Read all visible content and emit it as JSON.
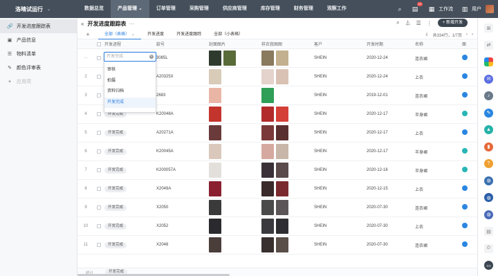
{
  "app": {
    "name": "洛晴试运行",
    "caret": "⌄"
  },
  "nav": [
    {
      "label": "数据总览",
      "active": false
    },
    {
      "label": "产品管理 ⌄",
      "active": true
    },
    {
      "label": "订单管理",
      "active": false
    },
    {
      "label": "采购管理",
      "active": false
    },
    {
      "label": "供应商管理",
      "active": false
    },
    {
      "label": "库存管理",
      "active": false
    },
    {
      "label": "财务管理",
      "active": false
    },
    {
      "label": "观察工作",
      "active": false
    }
  ],
  "topright": {
    "notif_count": "10",
    "workbench": "工作流",
    "user": "用户"
  },
  "sidebar": [
    {
      "label": "开发进度跟踪表",
      "icon": "link-icon",
      "glyph": "🔗",
      "active": true
    },
    {
      "label": "产品信息",
      "icon": "box-icon",
      "glyph": "▣",
      "active": false
    },
    {
      "label": "物料清单",
      "icon": "list-icon",
      "glyph": "☰",
      "active": false
    },
    {
      "label": "颜色评审表",
      "icon": "brush-icon",
      "glyph": "✎",
      "active": false
    },
    {
      "label": "应用项",
      "icon": "plus-icon",
      "glyph": "+",
      "active": false
    }
  ],
  "page": {
    "title": "开发进度跟踪表",
    "more": "···",
    "new_button": "+ 新增开发"
  },
  "tabs": [
    {
      "label": "全部（表格）",
      "active": true
    },
    {
      "label": "开发进度",
      "active": false
    },
    {
      "label": "开发进度跟踪",
      "active": false
    },
    {
      "label": "全部（小表格）",
      "active": false
    }
  ],
  "pager": {
    "text": "共334行，1/7页",
    "prev": "‹",
    "next": "›"
  },
  "columns": [
    "开发进程",
    "款号",
    "封面图片",
    "样衣我图图",
    "客户",
    "开发时期",
    "名称",
    "面"
  ],
  "status_options": [
    "审核",
    "拍摄",
    "资料归档",
    "开发完成"
  ],
  "status_selected": "开发完成",
  "status_placeholder": "开发完成",
  "rows": [
    {
      "num": "···",
      "status": "",
      "code": "3085L",
      "customer": "SHEIN",
      "date": "2020-12-24",
      "name": "连衣裙",
      "img1": [
        "#2f3a2e",
        "#5a6b3a"
      ],
      "img2": [
        "#8a7a5e",
        "#c3b08e"
      ],
      "dot": "b"
    },
    {
      "num": "2",
      "status": "",
      "code": "A20325X",
      "customer": "SHEIN",
      "date": "2020-12-24",
      "name": "上衣",
      "img1": [
        "#d8cbb8"
      ],
      "img2": [
        "#e4d3cc",
        "#d9c2b4"
      ],
      "dot": "b"
    },
    {
      "num": "3",
      "status": "",
      "code": "2683",
      "customer": "SHEIN",
      "date": "2019-12-01",
      "name": "连衣裙",
      "img1": [
        "#e9b6a6"
      ],
      "img2": [
        "#2f9e56"
      ],
      "dot": "b"
    },
    {
      "num": "4",
      "status": "开发完成",
      "code": "K20048A",
      "customer": "SHEIN",
      "date": "2020-12-17",
      "name": "半身裙",
      "img1": [
        "#c3342c"
      ],
      "img2": [
        "#b22a2a",
        "#d44038"
      ],
      "dot": "g"
    },
    {
      "num": "5",
      "status": "开发完成",
      "code": "A20271A",
      "customer": "SHEIN",
      "date": "2020-12-17",
      "name": "上衣",
      "img1": [
        "#6b3a3a"
      ],
      "img2": [
        "#7a3838",
        "#5a2f2f"
      ],
      "dot": "b"
    },
    {
      "num": "6",
      "status": "开发完成",
      "code": "K20045A",
      "customer": "SHEIN",
      "date": "2020-12-17",
      "name": "半身裙",
      "img1": [
        "#d9c8bb"
      ],
      "img2": [
        "#d6a9a0",
        "#c8b6a8"
      ],
      "dot": "g"
    },
    {
      "num": "7",
      "status": "开发完成",
      "code": "K200057A",
      "customer": "SHEIN",
      "date": "2020-12-16",
      "name": "半身裙",
      "img1": [
        "#e3e0db"
      ],
      "img2": [
        "#3a3038",
        "#5a4a4c"
      ],
      "dot": "g"
    },
    {
      "num": "8",
      "status": "开发完成",
      "code": "X2049A",
      "customer": "SHEIN",
      "date": "2020-12-15",
      "name": "上衣",
      "img1": [
        "#8a2030"
      ],
      "img2": [
        "#3a2a2a",
        "#7a2a2e"
      ],
      "dot": "b"
    },
    {
      "num": "9",
      "status": "开发完成",
      "code": "X2050",
      "customer": "SHEIN",
      "date": "2020-07-30",
      "name": "连衣裙",
      "img1": [
        "#3a3a3a"
      ],
      "img2": [
        "#4a4a4a",
        "#5b5558"
      ],
      "dot": "b"
    },
    {
      "num": "10",
      "status": "开发完成",
      "code": "X2052",
      "customer": "SHEIN",
      "date": "2020-07-30",
      "name": "上衣",
      "img1": [
        "#2a2a2e"
      ],
      "img2": [
        "#3a3a3e",
        "#2e2e32"
      ],
      "dot": "b"
    },
    {
      "num": "11",
      "status": "开发完成",
      "code": "X2048",
      "customer": "SHEIN",
      "date": "2020-07-30",
      "name": "连衣裙",
      "img1": [
        "#4a3e3a"
      ],
      "img2": [
        "#38302e",
        "#5a4e48"
      ],
      "dot": "b"
    }
  ],
  "footer": {
    "label": "统计",
    "pill": "开发完成"
  },
  "colors": {
    "topbar": "#454f5b",
    "accent": "#2a7ee0",
    "dot_blue": "#2a86e0",
    "dot_teal": "#28b5b5"
  },
  "rightbar_icons": [
    "grid-icon",
    "share-icon",
    "multicolor-app-icon",
    "message-icon",
    "bell-icon",
    "chat-icon",
    "photo-icon",
    "chart-icon",
    "help-icon",
    "globe-icon",
    "globe-icon",
    "globe-icon",
    "doc-icon",
    "clock-icon",
    "panel-icon"
  ]
}
